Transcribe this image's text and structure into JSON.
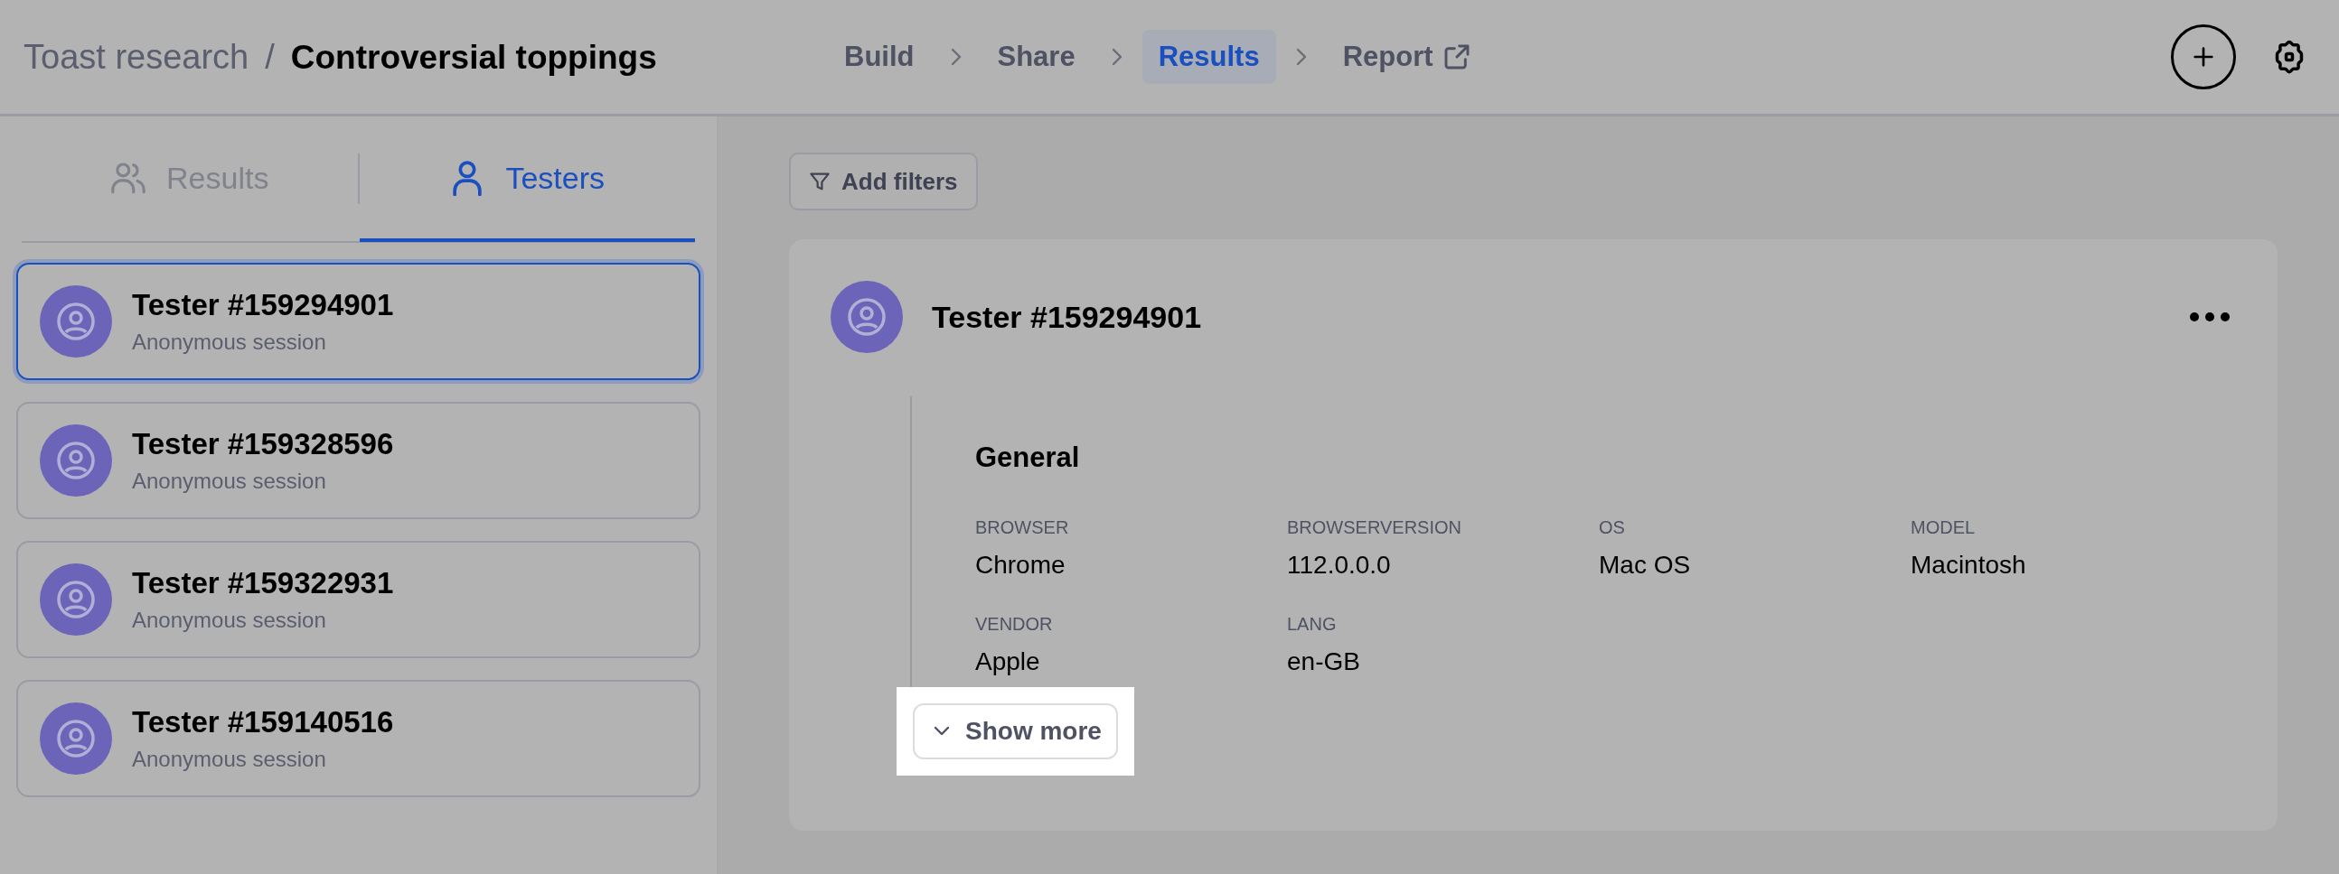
{
  "header": {
    "breadcrumb": {
      "parent": "Toast research",
      "separator": "/",
      "current": "Controversial toppings"
    },
    "steps": [
      {
        "label": "Build",
        "selected": false,
        "external": false
      },
      {
        "label": "Share",
        "selected": false,
        "external": false
      },
      {
        "label": "Results",
        "selected": true,
        "external": false
      },
      {
        "label": "Report",
        "selected": false,
        "external": true
      }
    ]
  },
  "sidebar": {
    "tabs": [
      {
        "label": "Results",
        "selected": false
      },
      {
        "label": "Testers",
        "selected": true
      }
    ],
    "testers": [
      {
        "name": "Tester #159294901",
        "subtitle": "Anonymous session",
        "selected": true
      },
      {
        "name": "Tester #159328596",
        "subtitle": "Anonymous session",
        "selected": false
      },
      {
        "name": "Tester #159322931",
        "subtitle": "Anonymous session",
        "selected": false
      },
      {
        "name": "Tester #159140516",
        "subtitle": "Anonymous session",
        "selected": false
      }
    ]
  },
  "main": {
    "filter_button": "Add filters",
    "detail": {
      "title": "Tester #159294901",
      "section": "General",
      "fields": [
        {
          "label": "BROWSER",
          "value": "Chrome"
        },
        {
          "label": "BROWSERVERSION",
          "value": "112.0.0.0"
        },
        {
          "label": "OS",
          "value": "Mac OS"
        },
        {
          "label": "MODEL",
          "value": "Macintosh"
        },
        {
          "label": "VENDOR",
          "value": "Apple"
        },
        {
          "label": "LANG",
          "value": "en-GB"
        }
      ],
      "show_more": {
        "label": "Show more",
        "highlighted": true
      }
    }
  }
}
